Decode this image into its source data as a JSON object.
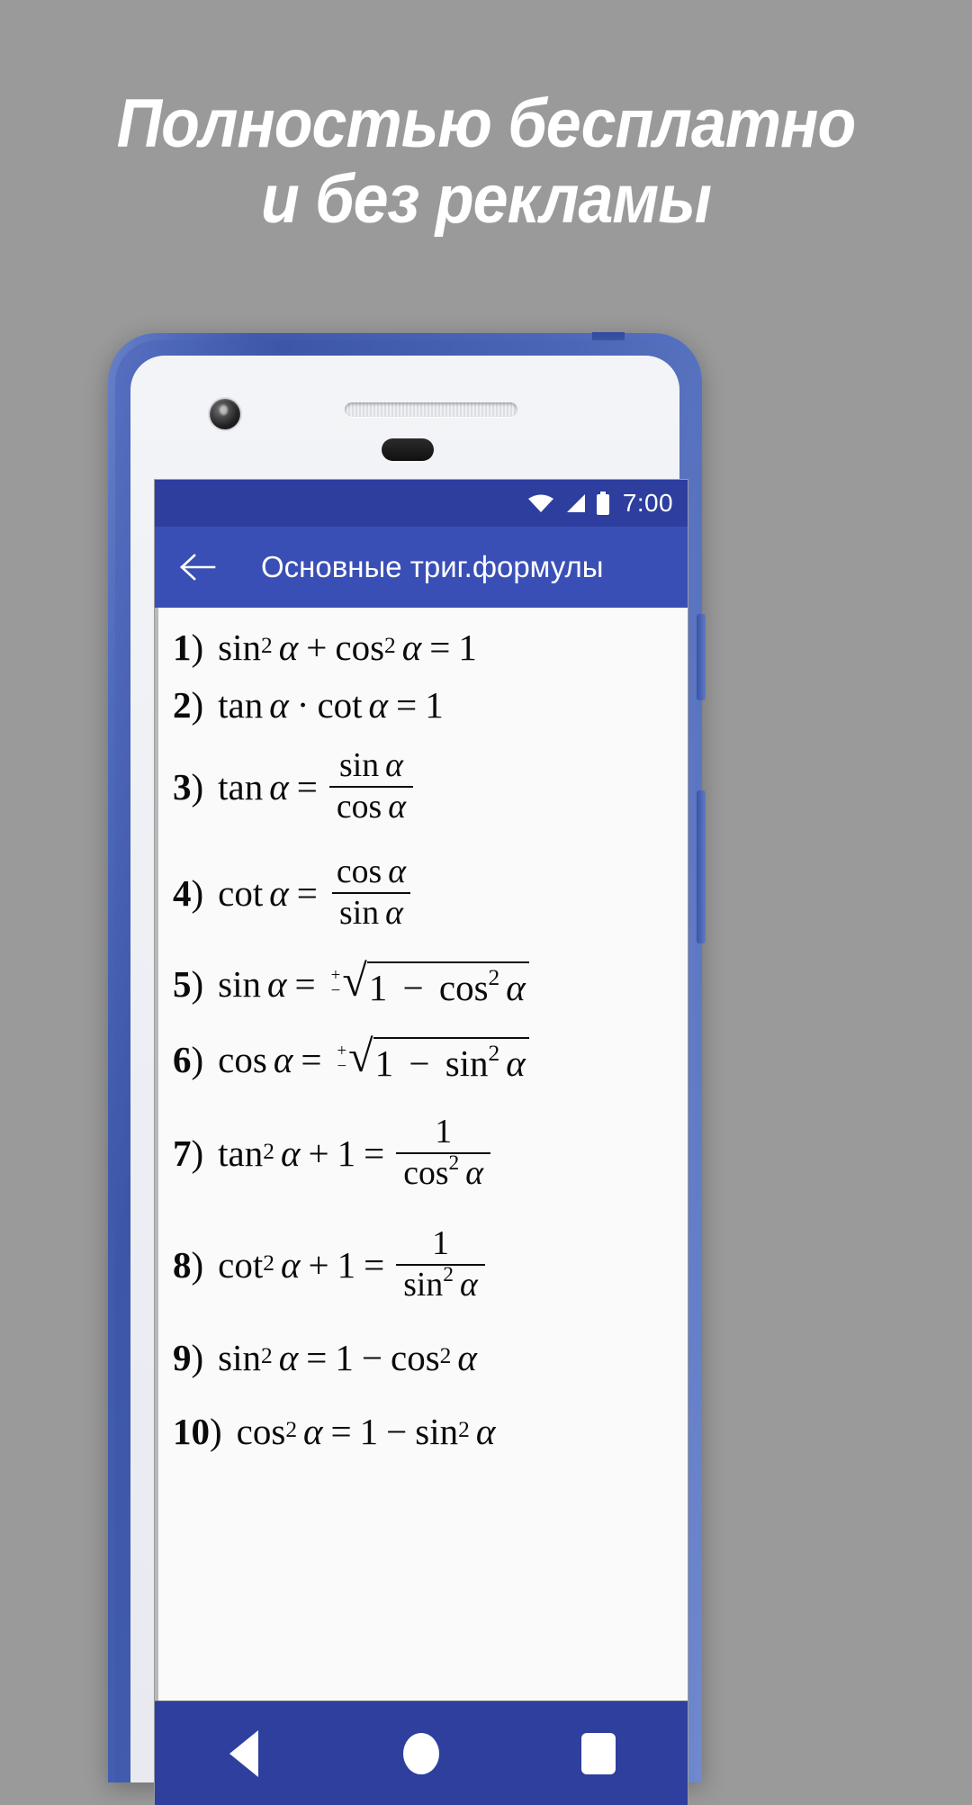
{
  "promo": {
    "background_color": "#9a9a9a",
    "headline_lines": [
      "Полностью бесплатно",
      "и без рекламы"
    ],
    "headline_color": "#ffffff"
  },
  "device": {
    "frame_color": "#4a66b8",
    "face_color": "#eceef3",
    "hardware": {
      "camera": "front-camera",
      "speaker": "earpiece-speaker",
      "sensor": "proximity-sensor",
      "power_button": "power-button",
      "volume_button": "volume-button"
    }
  },
  "app": {
    "statusbar": {
      "background_color": "#2d3e9e",
      "clock": "7:00",
      "icons": [
        "wifi-icon",
        "signal-icon",
        "battery-icon"
      ]
    },
    "appbar": {
      "background_color": "#3a4fb5",
      "back_label": "←",
      "title": "Основные триг.формулы"
    },
    "navbar": {
      "background_color": "#2e3f9e",
      "buttons": [
        "back-nav-button",
        "home-nav-button",
        "recents-nav-button"
      ]
    },
    "content": {
      "background_color": "#fafafa",
      "formulas": [
        {
          "num": "1",
          "latex": "sin^2 α + cos^2 α = 1"
        },
        {
          "num": "2",
          "latex": "tan α · cot α = 1"
        },
        {
          "num": "3",
          "latex": "tan α = sin α / cos α"
        },
        {
          "num": "4",
          "latex": "cot α = cos α / sin α"
        },
        {
          "num": "5",
          "latex": "sin α = ±√(1 − cos^2 α)"
        },
        {
          "num": "6",
          "latex": "cos α = ±√(1 − sin^2 α)"
        },
        {
          "num": "7",
          "latex": "tan^2 α + 1 = 1 / cos^2 α"
        },
        {
          "num": "8",
          "latex": "cot^2 α + 1 = 1 / sin^2 α"
        },
        {
          "num": "9",
          "latex": "sin^2 α = 1 − cos^2 α"
        },
        {
          "num": "10",
          "latex": "cos^2 α = 1 − sin^2 α"
        }
      ],
      "tokens": {
        "n1": "1",
        "n2": "2",
        "n3": "3",
        "n4": "4",
        "n5": "5",
        "n6": "6",
        "n7": "7",
        "n8": "8",
        "n9": "9",
        "n10": "10",
        "paren": ")",
        "sin": "sin",
        "cos": "cos",
        "tan": "tan",
        "cot": "cot",
        "alpha": "α",
        "one": "1",
        "two": "2",
        "eq": "=",
        "plus": "+",
        "minus": "−",
        "cdot": "·",
        "pm_top": "+",
        "pm_bottom": "−",
        "radical": "√"
      }
    }
  }
}
